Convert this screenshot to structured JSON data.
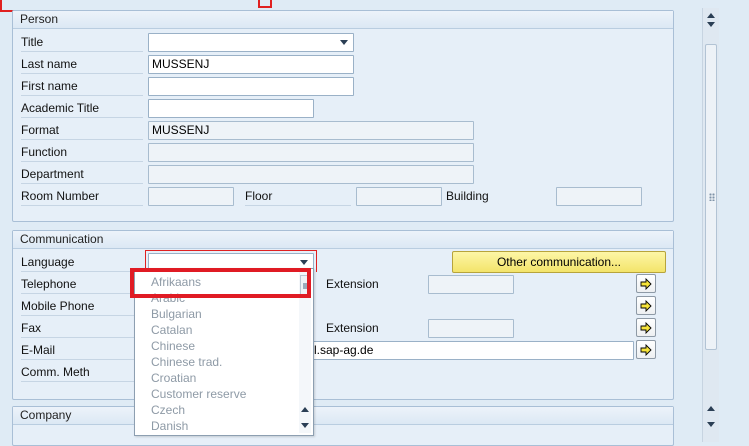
{
  "person": {
    "group_title": "Person",
    "title_label": "Title",
    "title_value": "",
    "last_name_label": "Last name",
    "last_name_value": "MUSSENJ",
    "first_name_label": "First name",
    "first_name_value": "",
    "academic_title_label": "Academic Title",
    "academic_title_value": "",
    "format_label": "Format",
    "format_value": "MUSSENJ",
    "function_label": "Function",
    "function_value": "",
    "department_label": "Department",
    "department_value": "",
    "room_number_label": "Room Number",
    "room_number_value": "",
    "floor_label": "Floor",
    "floor_value": "",
    "building_label": "Building",
    "building_value": ""
  },
  "communication": {
    "group_title": "Communication",
    "language_label": "Language",
    "language_value": "",
    "other_comm_button": "Other communication...",
    "telephone_label": "Telephone",
    "extension_label": "Extension",
    "mobile_label": "Mobile Phone",
    "fax_label": "Fax",
    "fax_extension_label": "Extension",
    "email_label": "E-Mail",
    "email_value_visible": "l.sap-ag.de",
    "comm_meth_label": "Comm. Meth"
  },
  "company": {
    "group_title": "Company"
  },
  "language_dropdown": {
    "items": [
      "Afrikaans",
      "Arabic",
      "Bulgarian",
      "Catalan",
      "Chinese",
      "Chinese trad.",
      "Croatian",
      "Customer reserve",
      "Czech",
      "Danish"
    ]
  },
  "colors": {
    "accent_highlight": "#e01b24",
    "button_yellow": "#f3e46a",
    "panel_bg": "#dfebf5"
  }
}
